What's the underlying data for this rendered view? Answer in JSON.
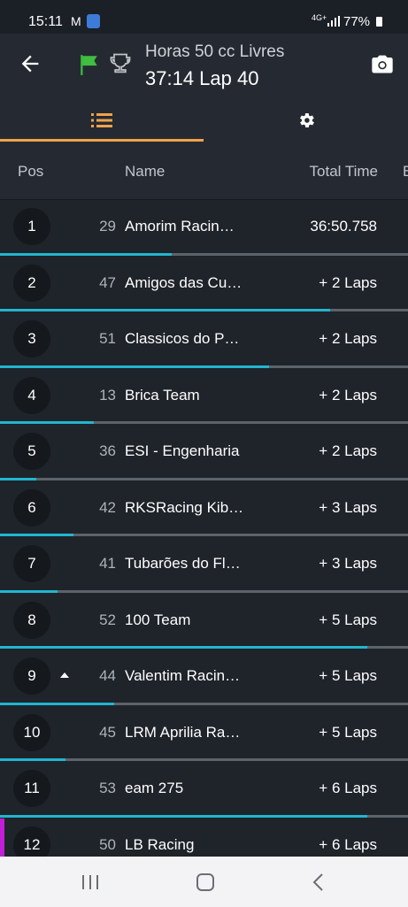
{
  "status_bar": {
    "time": "15:11",
    "network": "4G+",
    "battery": "77%"
  },
  "header": {
    "title": "Horas 50 cc Livres",
    "subtitle": "37:14  Lap 40"
  },
  "tabs": [
    {
      "icon": "list-icon",
      "active": true
    },
    {
      "icon": "gear-icon",
      "active": false
    }
  ],
  "columns": {
    "pos": "Pos",
    "name": "Name",
    "total_time": "Total Time",
    "extra": "B"
  },
  "rows": [
    {
      "pos": "1",
      "num": "29",
      "name": "Amorim Racin…",
      "time": "36:50.758",
      "progress": 0.42,
      "trend": ""
    },
    {
      "pos": "2",
      "num": "47",
      "name": "Amigos das Cu…",
      "time": "+ 2 Laps",
      "progress": 0.81,
      "trend": ""
    },
    {
      "pos": "3",
      "num": "51",
      "name": "Classicos do P…",
      "time": "+ 2 Laps",
      "progress": 0.66,
      "trend": ""
    },
    {
      "pos": "4",
      "num": "13",
      "name": "Brica Team",
      "time": "+ 2 Laps",
      "progress": 0.23,
      "trend": ""
    },
    {
      "pos": "5",
      "num": "36",
      "name": "ESI - Engenharia",
      "time": "+ 2 Laps",
      "progress": 0.09,
      "trend": ""
    },
    {
      "pos": "6",
      "num": "42",
      "name": "RKSRacing Kib…",
      "time": "+ 3 Laps",
      "progress": 0.18,
      "trend": ""
    },
    {
      "pos": "7",
      "num": "41",
      "name": "Tubarões do Fl…",
      "time": "+ 3 Laps",
      "progress": 0.14,
      "trend": ""
    },
    {
      "pos": "8",
      "num": "52",
      "name": "100 Team",
      "time": "+ 5 Laps",
      "progress": 0.9,
      "trend": ""
    },
    {
      "pos": "9",
      "num": "44",
      "name": "Valentim Racin…",
      "time": "+ 5 Laps",
      "progress": 0.28,
      "trend": "up"
    },
    {
      "pos": "10",
      "num": "45",
      "name": "LRM Aprilia Ra…",
      "time": "+ 5 Laps",
      "progress": 0.16,
      "trend": ""
    },
    {
      "pos": "11",
      "num": "53",
      "name": "eam 275",
      "time": "+ 6 Laps",
      "progress": 0.9,
      "trend": ""
    },
    {
      "pos": "12",
      "num": "50",
      "name": "LB Racing",
      "time": "+ 6 Laps",
      "progress": 0.0,
      "trend": "",
      "marker": true
    }
  ],
  "colors": {
    "accent": "#f0a34a",
    "progress": "#20b6cf",
    "flag": "#3fbf3f",
    "marker": "#c21ed8"
  }
}
